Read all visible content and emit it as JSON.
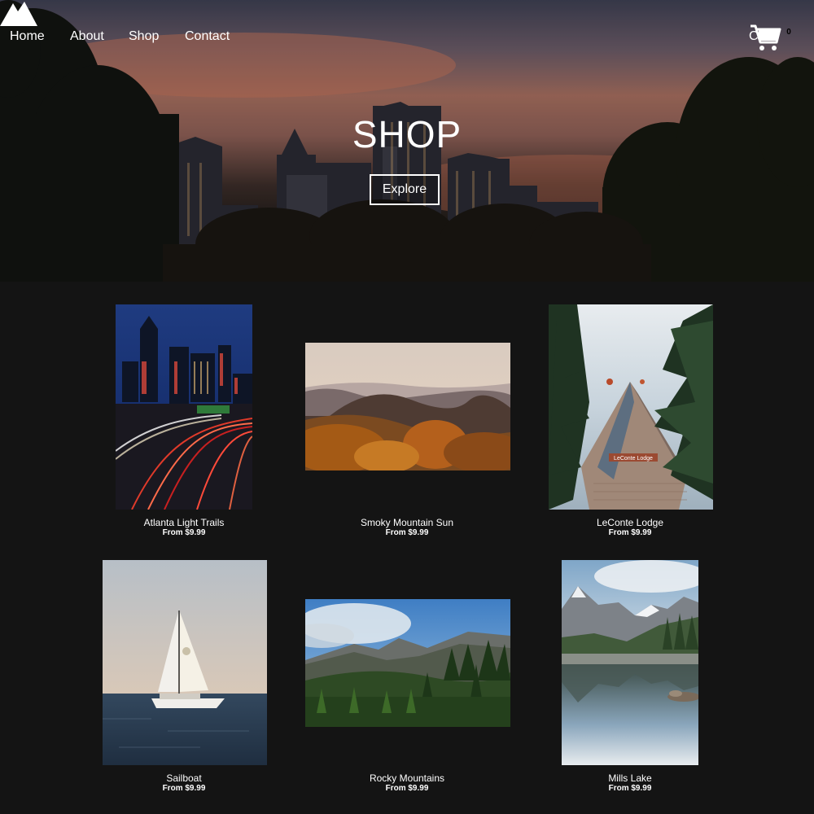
{
  "nav": {
    "links": [
      "Home",
      "About",
      "Shop",
      "Contact"
    ],
    "logo_icon": "mountain-logo-icon",
    "cart_label": "Cart",
    "cart_count": "0",
    "cart_icon": "shopping-cart-icon"
  },
  "hero": {
    "title": "SHOP",
    "button_label": "Explore"
  },
  "products": [
    {
      "name": "Atlanta Light Trails",
      "price": "From $9.99"
    },
    {
      "name": "Smoky Mountain Sun",
      "price": "From $9.99"
    },
    {
      "name": "LeConte Lodge",
      "price": "From $9.99"
    },
    {
      "name": "Sailboat",
      "price": "From $9.99"
    },
    {
      "name": "Rocky Mountains",
      "price": "From $9.99"
    },
    {
      "name": "Mills Lake",
      "price": "From $9.99"
    }
  ],
  "lodge_sign": "LeConte Lodge",
  "colors": {
    "background": "#141414",
    "text": "#ffffff"
  }
}
